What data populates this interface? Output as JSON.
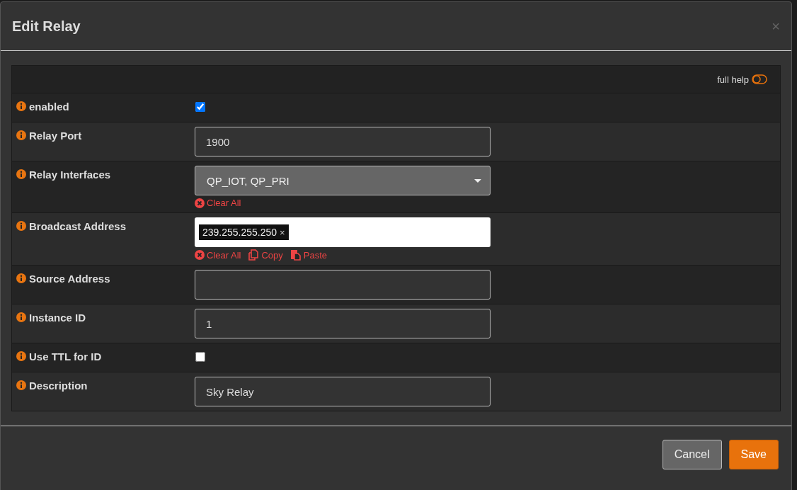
{
  "dialog": {
    "title": "Edit Relay",
    "close": "×"
  },
  "help": {
    "label": "full help",
    "on": false
  },
  "fields": [
    {
      "kind": "checkbox",
      "label": "enabled",
      "checked": true
    },
    {
      "kind": "text",
      "label": "Relay Port",
      "value": "1900"
    },
    {
      "kind": "select",
      "label": "Relay Interfaces",
      "value": "QP_IOT, QP_PRI",
      "actions": [
        {
          "kind": "clear",
          "label": "Clear All"
        }
      ]
    },
    {
      "kind": "tokens",
      "label": "Broadcast Address",
      "tokens": [
        {
          "text": "239.255.255.250",
          "remove": "×"
        }
      ],
      "actions": [
        {
          "kind": "clear",
          "label": "Clear All"
        },
        {
          "kind": "copy",
          "label": "Copy"
        },
        {
          "kind": "paste",
          "label": "Paste"
        }
      ]
    },
    {
      "kind": "text",
      "label": "Source Address"
    },
    {
      "kind": "text",
      "label": "Instance ID",
      "value": "1"
    },
    {
      "kind": "checkbox",
      "label": "Use TTL for ID",
      "checked": false
    },
    {
      "kind": "text",
      "label": "Description",
      "value": "Sky Relay"
    }
  ],
  "buttons": [
    {
      "kind": "secondary",
      "label": "Cancel"
    },
    {
      "kind": "primary",
      "label": "Save"
    }
  ]
}
